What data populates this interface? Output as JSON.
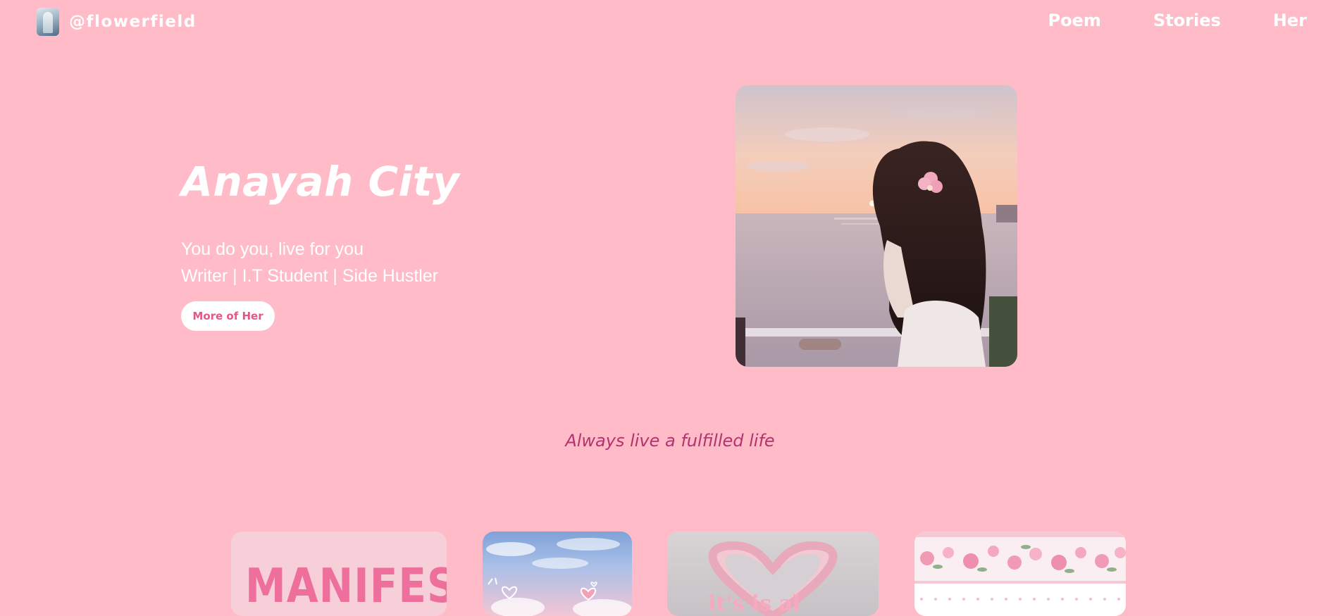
{
  "header": {
    "handle": "@flowerfield",
    "nav": [
      {
        "label": "Poem"
      },
      {
        "label": "Stories"
      },
      {
        "label": "Her"
      }
    ]
  },
  "hero": {
    "title": "Anayah City",
    "tagline": "You do you, live for you",
    "roles": "Writer | I.T Student | Side Hustler",
    "cta_label": "More of Her"
  },
  "quote": "Always live a fulfilled life",
  "cards": [
    {
      "text": "MANIFEST"
    },
    {
      "text": ""
    },
    {
      "text": "it's is al"
    },
    {
      "text": ""
    }
  ],
  "colors": {
    "background": "#ffbcc8",
    "quote": "#b3336f",
    "cta_text": "#e8548a"
  }
}
